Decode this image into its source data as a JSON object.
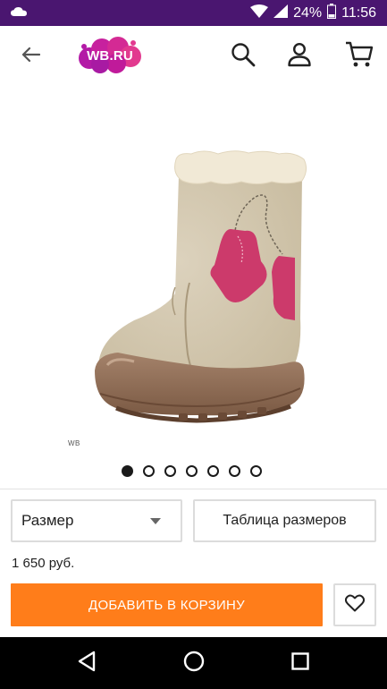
{
  "status_bar": {
    "battery_percent": "24%",
    "time": "11:56",
    "icons": [
      "cloud-icon",
      "wifi-icon",
      "signal-icon",
      "battery-icon"
    ]
  },
  "app_bar": {
    "logo_text": "WB.RU",
    "brand_colors": {
      "logo_primary": "#b31aa6",
      "logo_secondary": "#e23a8f"
    },
    "icons": [
      "back-arrow-icon",
      "search-icon",
      "account-icon",
      "cart-icon"
    ]
  },
  "gallery": {
    "image_caption": "WB",
    "total_images": 7,
    "active_index": 0
  },
  "product": {
    "size_select": {
      "label": "Размер"
    },
    "size_table_label": "Таблица размеров",
    "price": "1 650 руб.",
    "add_to_cart_label": "ДОБАВИТЬ В КОРЗИНУ",
    "accent_color": "#ff7d1a"
  },
  "nav_bar": {
    "icons": [
      "back-triangle-icon",
      "home-circle-icon",
      "recents-square-icon"
    ]
  }
}
